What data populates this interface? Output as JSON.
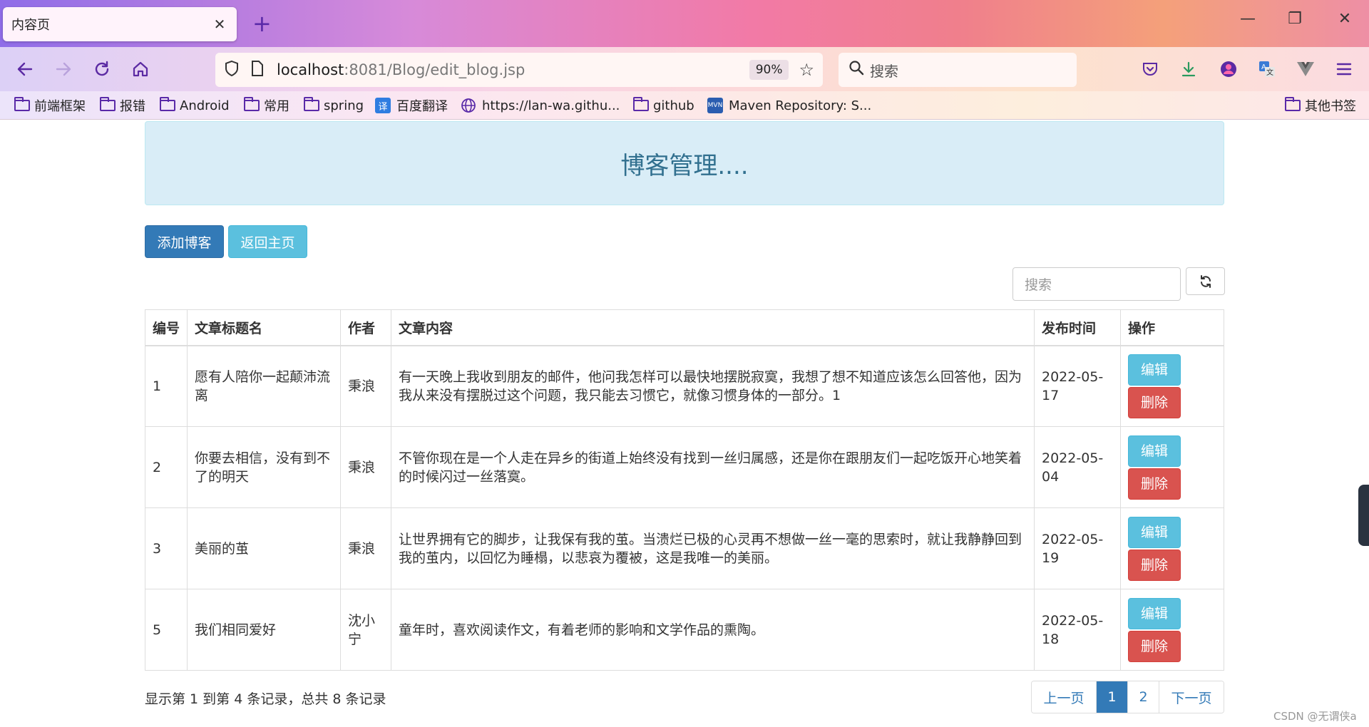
{
  "browser": {
    "tab_title": "内容页",
    "tab_close": "✕",
    "new_tab": "+",
    "window_controls": {
      "minimize": "—",
      "restore": "❐",
      "close": "✕"
    },
    "url_host": "localhost",
    "url_rest": ":8081/Blog/edit_blog.jsp",
    "zoom": "90%",
    "search_placeholder": "搜索",
    "bookmarks": [
      {
        "label": "前端框架",
        "icon": "folder-icon"
      },
      {
        "label": "报错",
        "icon": "folder-icon"
      },
      {
        "label": "Android",
        "icon": "folder-icon"
      },
      {
        "label": "常用",
        "icon": "folder-icon"
      },
      {
        "label": "spring",
        "icon": "folder-icon"
      },
      {
        "label": "百度翻译",
        "icon": "baidu-translate-icon"
      },
      {
        "label": "https://lan-wa.githu...",
        "icon": "globe-icon"
      },
      {
        "label": "github",
        "icon": "folder-icon"
      },
      {
        "label": "Maven Repository: S...",
        "icon": "maven-icon"
      }
    ],
    "other_bookmarks": "其他书签"
  },
  "page": {
    "header_title": "博客管理....",
    "add_button": "添加博客",
    "home_button": "返回主页",
    "search_placeholder": "搜索",
    "table": {
      "headers": [
        "编号",
        "文章标题名",
        "作者",
        "文章内容",
        "发布时间",
        "操作"
      ],
      "rows": [
        {
          "id": "1",
          "title": "愿有人陪你一起颠沛流离",
          "author": "秉浪",
          "content": "有一天晚上我收到朋友的邮件，他问我怎样可以最快地摆脱寂寞，我想了想不知道应该怎么回答他，因为我从来没有摆脱过这个问题，我只能去习惯它，就像习惯身体的一部分。1",
          "date": "2022-05-17"
        },
        {
          "id": "2",
          "title": "你要去相信，没有到不了的明天",
          "author": "秉浪",
          "content": "不管你现在是一个人走在异乡的街道上始终没有找到一丝归属感，还是你在跟朋友们一起吃饭开心地笑着的时候闪过一丝落寞。",
          "date": "2022-05-04"
        },
        {
          "id": "3",
          "title": "美丽的茧",
          "author": "秉浪",
          "content": "让世界拥有它的脚步，让我保有我的茧。当溃烂已极的心灵再不想做一丝一毫的思索时，就让我静静回到我的茧内，以回忆为睡榻，以悲哀为覆被，这是我唯一的美丽。",
          "date": "2022-05-19"
        },
        {
          "id": "5",
          "title": "我们相同爱好",
          "author": "沈小宁",
          "content": "童年时，喜欢阅读作文，有着老师的影响和文学作品的熏陶。",
          "date": "2022-05-18"
        }
      ],
      "edit_label": "编辑",
      "delete_label": "删除"
    },
    "summary": "显示第 1 到第 4 条记录，总共 8 条记录",
    "pager": {
      "prev": "上一页",
      "pages": [
        "1",
        "2"
      ],
      "active_page": "1",
      "next": "下一页"
    },
    "watermark": "CSDN @无谓侠a"
  },
  "colors": {
    "primary": "#337ab7",
    "info": "#5bc0de",
    "danger": "#d9534f",
    "jumbo_bg": "#d9edf7",
    "jumbo_text": "#31708f"
  }
}
